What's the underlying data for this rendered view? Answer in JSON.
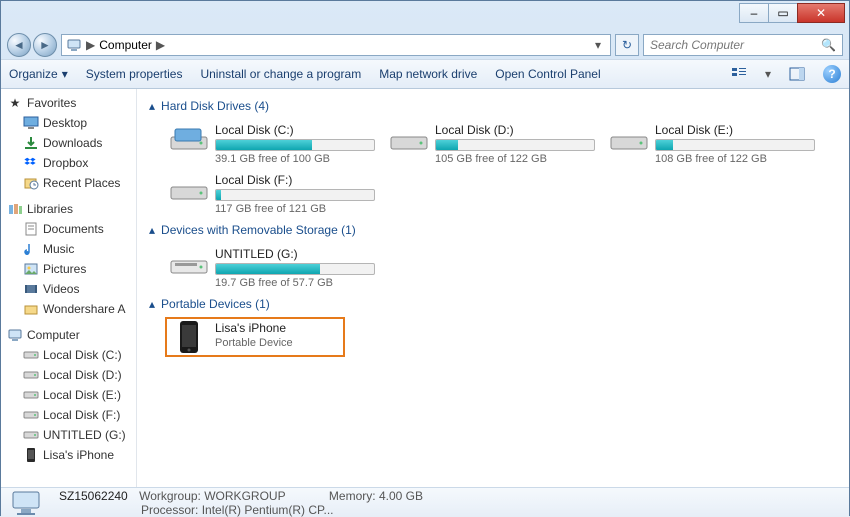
{
  "titlebar": {
    "minimize": "–",
    "maximize": "▭",
    "close": "✕"
  },
  "address": {
    "back": "◄",
    "forward": "►",
    "location": "Computer",
    "sep": "▶",
    "dropdown": "▾",
    "refresh": "↻",
    "search_placeholder": "Search Computer",
    "search_icon": "🔍"
  },
  "toolbar": {
    "organize": "Organize",
    "organize_caret": "▾",
    "sysprops": "System properties",
    "uninstall": "Uninstall or change a program",
    "mapdrive": "Map network drive",
    "controlpanel": "Open Control Panel",
    "help": "?"
  },
  "sidebar": {
    "favorites": {
      "label": "Favorites",
      "items": [
        {
          "label": "Desktop"
        },
        {
          "label": "Downloads"
        },
        {
          "label": "Dropbox"
        },
        {
          "label": "Recent Places"
        }
      ]
    },
    "libraries": {
      "label": "Libraries",
      "items": [
        {
          "label": "Documents"
        },
        {
          "label": "Music"
        },
        {
          "label": "Pictures"
        },
        {
          "label": "Videos"
        },
        {
          "label": "Wondershare A"
        }
      ]
    },
    "computer": {
      "label": "Computer",
      "items": [
        {
          "label": "Local Disk (C:)"
        },
        {
          "label": "Local Disk (D:)"
        },
        {
          "label": "Local Disk (E:)"
        },
        {
          "label": "Local Disk (F:)"
        },
        {
          "label": "UNTITLED (G:)"
        },
        {
          "label": "Lisa's iPhone"
        }
      ]
    }
  },
  "content": {
    "hdd": {
      "header": "Hard Disk Drives (4)",
      "drives": [
        {
          "name": "Local Disk (C:)",
          "free": "39.1 GB free of 100 GB",
          "fill": 61
        },
        {
          "name": "Local Disk (D:)",
          "free": "105 GB free of 122 GB",
          "fill": 14
        },
        {
          "name": "Local Disk (E:)",
          "free": "108 GB free of 122 GB",
          "fill": 11
        },
        {
          "name": "Local Disk (F:)",
          "free": "117 GB free of 121 GB",
          "fill": 3
        }
      ]
    },
    "removable": {
      "header": "Devices with Removable Storage (1)",
      "drives": [
        {
          "name": "UNTITLED (G:)",
          "free": "19.7 GB free of 57.7 GB",
          "fill": 66
        }
      ]
    },
    "portable": {
      "header": "Portable Devices (1)",
      "devices": [
        {
          "name": "Lisa's iPhone",
          "type": "Portable Device"
        }
      ]
    },
    "caret": "▴"
  },
  "status": {
    "name": "SZ15062240",
    "workgroup_label": "Workgroup:",
    "workgroup": "WORKGROUP",
    "processor_label": "Processor:",
    "processor": "Intel(R) Pentium(R) CP...",
    "memory_label": "Memory:",
    "memory": "4.00 GB"
  }
}
